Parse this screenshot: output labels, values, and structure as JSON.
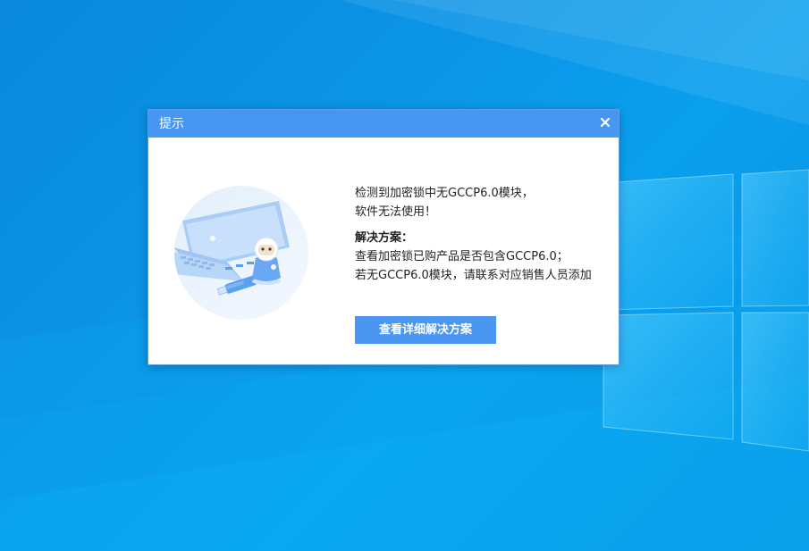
{
  "desktop": {
    "background_color": "#0b94e6"
  },
  "dialog": {
    "title": "提示",
    "close_icon": "close-icon",
    "illustration": "usb-dongle-laptop-illustration",
    "message": {
      "line1": "检测到加密锁中无GCCP6.0模块，",
      "line2": "软件无法使用！",
      "solution_heading": "解决方案：",
      "solution_line1": "查看加密锁已购产品是否包含GCCP6.0；",
      "solution_line2": "若无GCCP6.0模块，请联系对应销售人员添加"
    },
    "action_button_label": "查看详细解决方案",
    "accent_color": "#4797f2"
  }
}
